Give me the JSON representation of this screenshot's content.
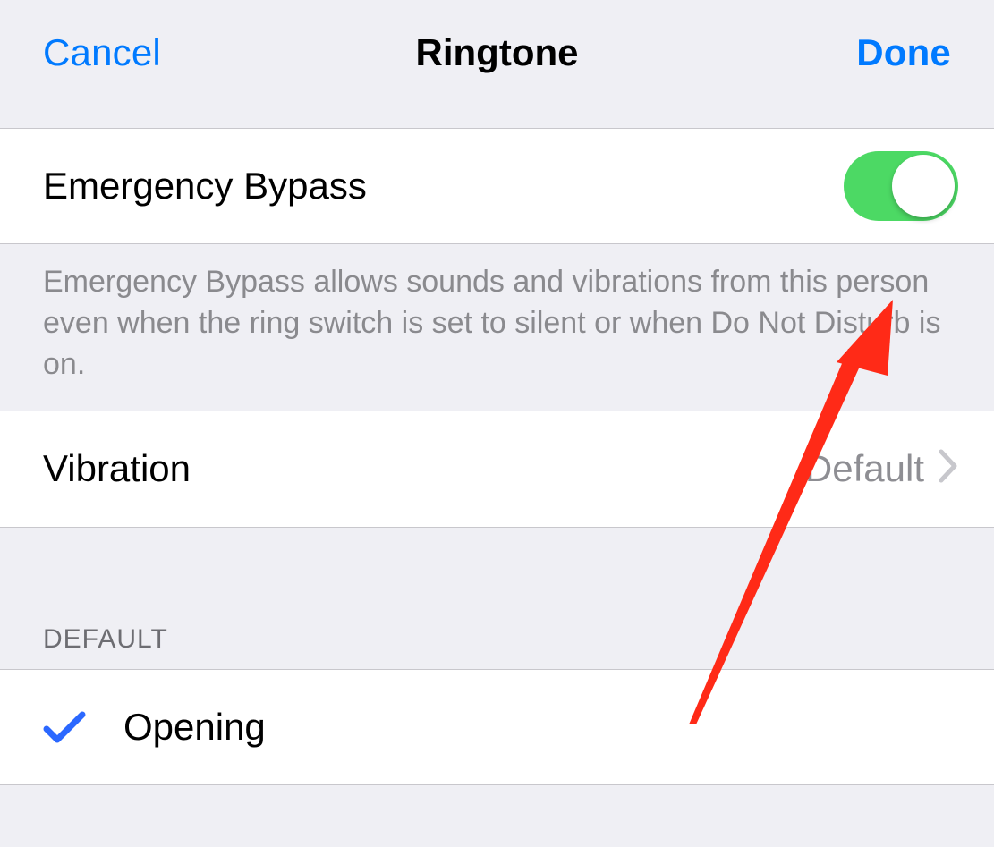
{
  "nav": {
    "cancel": "Cancel",
    "title": "Ringtone",
    "done": "Done"
  },
  "emergency_bypass": {
    "label": "Emergency Bypass",
    "enabled": true,
    "note": "Emergency Bypass allows sounds and vibrations from this person even when the ring switch is set to silent or when Do Not Disturb is on."
  },
  "vibration": {
    "label": "Vibration",
    "value": "Default"
  },
  "section_header": "DEFAULT",
  "ringtones": [
    {
      "label": "Opening",
      "selected": true
    }
  ],
  "colors": {
    "ios_blue": "#007aff",
    "switch_green": "#4cd964",
    "annotation_red": "#ff2a17"
  }
}
